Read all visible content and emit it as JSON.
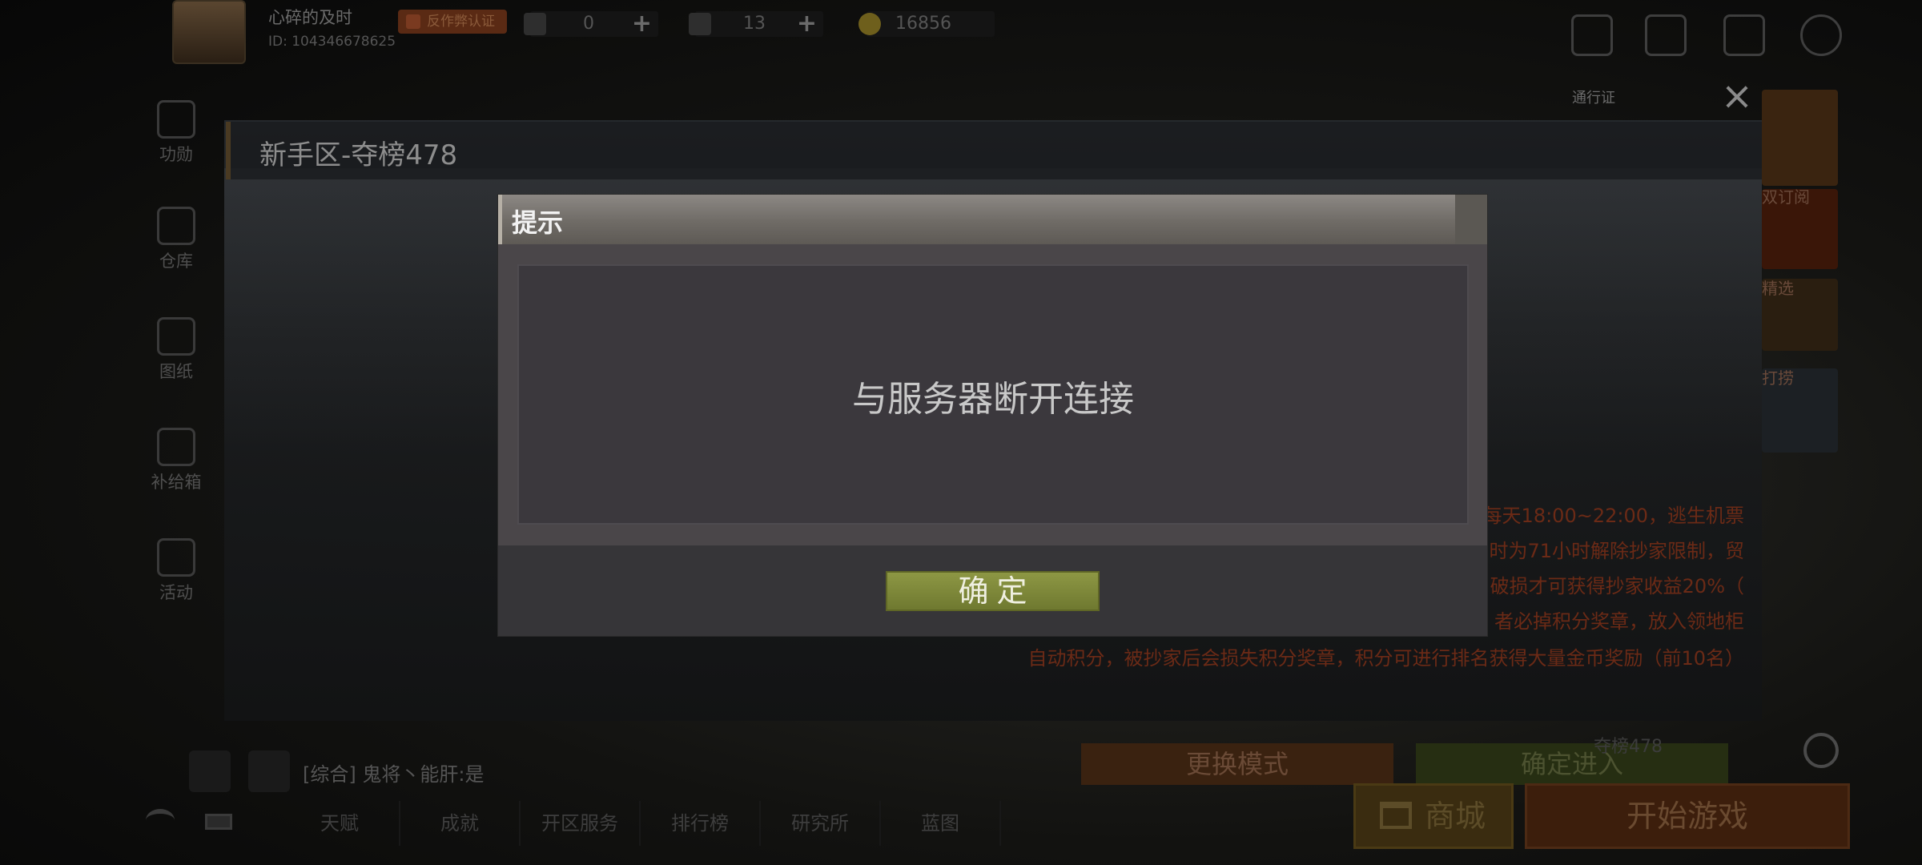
{
  "player": {
    "name": "心碎的及时",
    "id": "ID: 104346678625",
    "badge": "反作弊认证"
  },
  "resources": [
    {
      "name": "ticket-icon",
      "value": "0"
    },
    {
      "name": "gem-icon",
      "value": "13"
    },
    {
      "name": "gold-coin-icon",
      "value": "16856"
    }
  ],
  "top_right": {
    "pass_label": "通行证"
  },
  "left_nav": [
    {
      "label": "功勋",
      "icon": "medal-icon"
    },
    {
      "label": "仓库",
      "icon": "warehouse-icon"
    },
    {
      "label": "图纸",
      "icon": "blueprint-icon"
    },
    {
      "label": "补给箱",
      "icon": "supply-box-icon"
    },
    {
      "label": "活动",
      "icon": "event-icon"
    }
  ],
  "right_tiles": {
    "subscribe": "双订阅",
    "select": "精选",
    "fight": "打捞"
  },
  "server": {
    "title": "新手区-夺榜478"
  },
  "description": [
    "每天18:00~22:00，逃生机票",
    "时为71小时解除抄家限制，贸",
    "破损才可获得抄家收益20%（",
    "者必掉积分奖章，放入领地柜",
    "自动积分，被抄家后会损失积分奖章，积分可进行排名获得大量金币奖励（前10名）"
  ],
  "buttons": {
    "change_mode": "更换模式",
    "confirm_enter": "确定进入",
    "shop": "商城",
    "start_game": "开始游戏",
    "rank_label": "夺榜478"
  },
  "chat": {
    "channel": "[综合]",
    "message": "鬼将丶能肝:是"
  },
  "bottom_nav": [
    "天赋",
    "成就",
    "开区服务",
    "排行榜",
    "研究所",
    "蓝图"
  ],
  "dialog": {
    "title": "提示",
    "message": "与服务器断开连接",
    "ok_label": "确定"
  }
}
